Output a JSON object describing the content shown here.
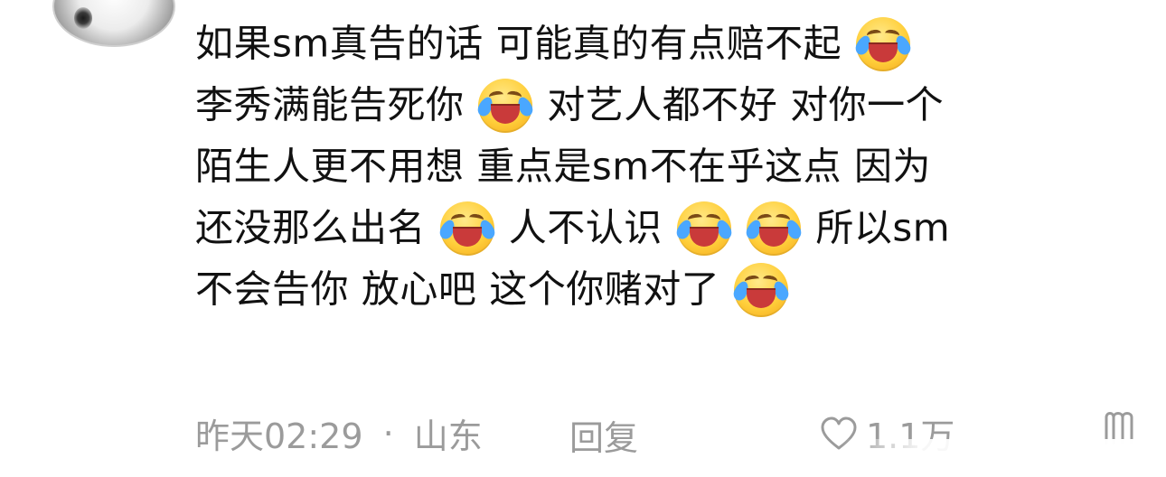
{
  "comment": {
    "lines": [
      {
        "text": "如果sm真告的话 可能真的有点赔不起"
      },
      {
        "text_before": "李秀满能告死你",
        "text_after": " 对艺人都不好 对你一个"
      },
      {
        "text": "陌生人更不用想 重点是sm不在乎这点 因为"
      },
      {
        "text_before": "还没那么出名",
        "text_middle": " 人不认识",
        "text_after": " 所以sm"
      },
      {
        "text": "不会告你 放心吧 这个你赌对了"
      }
    ],
    "emoji_name": "laughing-crying-emoji"
  },
  "meta": {
    "time": "昨天02:29",
    "separator": "·",
    "location": "山东",
    "reply_label": "回复",
    "like_count": "1.1万"
  },
  "icons": {
    "like": "heart-outline-icon",
    "more": "more-icon"
  },
  "colors": {
    "text": "#111111",
    "meta": "#9b9b9b",
    "emoji": "#ffcf3b"
  }
}
